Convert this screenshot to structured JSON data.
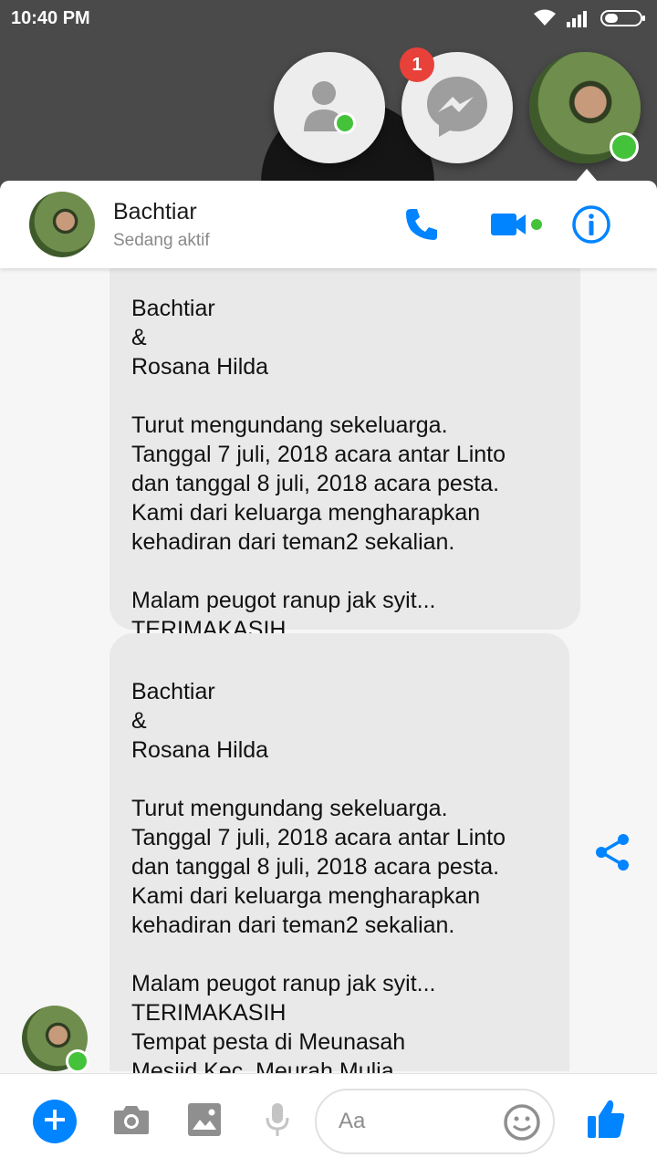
{
  "status_bar": {
    "time": "10:40 PM",
    "icons": [
      "wifi-icon",
      "signal-icon",
      "battery-icon"
    ]
  },
  "chat_heads": {
    "badge_count": "1",
    "items": [
      "contacts-icon",
      "messenger-icon",
      "profile-photo"
    ]
  },
  "conversation": {
    "name": "Bachtiar",
    "status": "Sedang aktif"
  },
  "messages": [
    {
      "text": "Bachtiar\n&\nRosana Hilda\n\nTurut mengundang sekeluarga.\nTanggal 7 juli, 2018 acara antar Linto\ndan tanggal 8 juli, 2018 acara pesta.\nKami dari keluarga mengharapkan\nkehadiran dari teman2 sekalian.\n\nMalam peugot ranup jak syit...\nTERIMAKASIH"
    },
    {
      "text": "Bachtiar\n&\nRosana Hilda\n\nTurut mengundang sekeluarga.\nTanggal 7 juli, 2018 acara antar Linto\ndan tanggal 8 juli, 2018 acara pesta.\nKami dari keluarga mengharapkan\nkehadiran dari teman2 sekalian.\n\nMalam peugot ranup jak syit...\nTERIMAKASIH\nTempat pesta di Meunasah",
      "link_text": "Mesjid.Kec",
      "tail_text": ". Meurah Mulia"
    }
  ],
  "composer": {
    "placeholder": "Aa"
  },
  "colors": {
    "accent": "#0084ff",
    "online": "#44c23a",
    "badge": "#e8413a",
    "bubble": "#e9e9e9"
  }
}
